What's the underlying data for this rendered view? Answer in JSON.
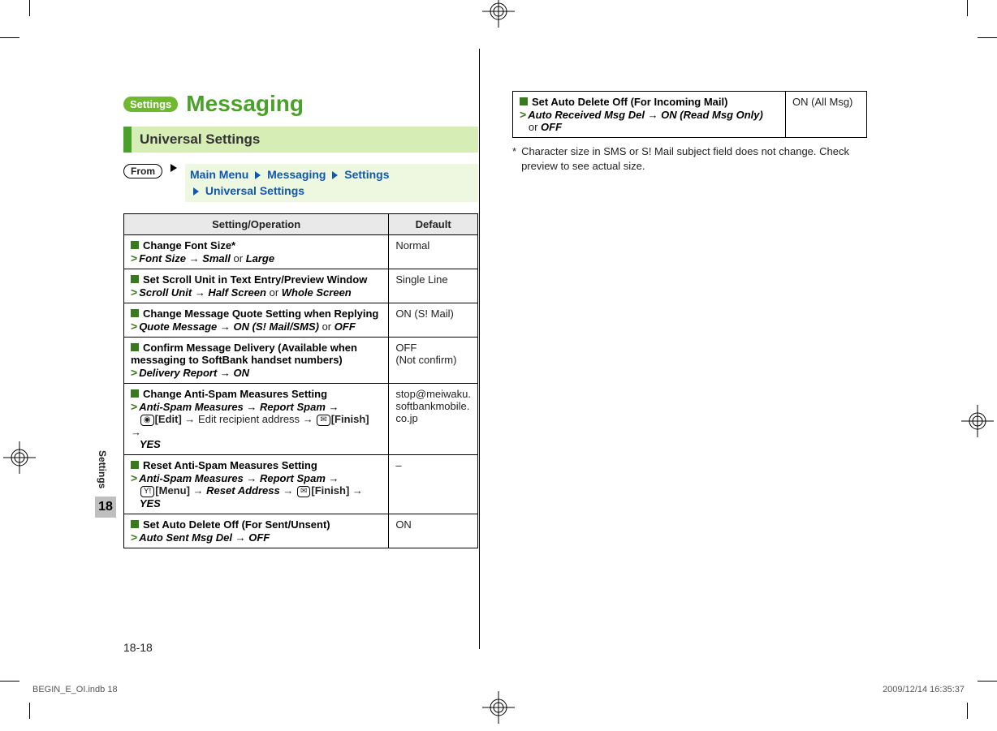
{
  "header": {
    "pill": "Settings",
    "title": "Messaging"
  },
  "section_title": "Universal Settings",
  "from_label": "From",
  "breadcrumb": {
    "p1": "Main Menu",
    "p2": "Messaging",
    "p3": "Settings",
    "p4": "Universal Settings"
  },
  "table_header": {
    "col1": "Setting/Operation",
    "col2": "Default"
  },
  "rows": [
    {
      "title": "Change Font Size*",
      "path_html": "<span class='chev'>&gt;</span><span class='path'>Font Size <span class='arr'>→</span> Small</span> <span class='normal'>or</span> <span class='path'>Large</span>",
      "default": "Normal"
    },
    {
      "title": "Set Scroll Unit in Text Entry/Preview Window",
      "path_html": "<span class='chev'>&gt;</span><span class='path'>Scroll Unit <span class='arr'>→</span> Half Screen</span> <span class='normal'>or</span> <span class='path'>Whole Screen</span>",
      "default": "Single Line"
    },
    {
      "title": "Change Message Quote Setting when Replying",
      "path_html": "<span class='chev'>&gt;</span><span class='path'>Quote Message <span class='arr'>→</span> ON (S! Mail/SMS)</span> <span class='normal'>or</span> <span class='path'>OFF</span>",
      "default": "ON (S! Mail)"
    },
    {
      "title": "Confirm Message Delivery (Available when messaging to SoftBank handset numbers)",
      "path_html": "<span class='chev'>&gt;</span><span class='path'>Delivery Report <span class='arr'>→</span> ON</span>",
      "default": "OFF<br>(Not confirm)"
    },
    {
      "title": "Change Anti-Spam Measures Setting",
      "path_html": "<span class='chev'>&gt;</span><span class='path'>Anti-Spam Measures <span class='arr'>→</span> Report Spam <span class='arr'>→</span></span><br>&nbsp;&nbsp;&nbsp;<span class='key'>◉</span><span class='bold'>[Edit]</span> <span class='arr'>→</span> <span class='normal'>Edit recipient address</span> <span class='arr'>→</span> <span class='key'>✉</span><span class='bold'>[Finish]</span> <span class='arr'>→</span><br>&nbsp;&nbsp;&nbsp;<span class='path'>YES</span>",
      "default": "stop@meiwaku.<br>softbankmobile.<br>co.jp"
    },
    {
      "title": "Reset Anti-Spam Measures Setting",
      "path_html": "<span class='chev'>&gt;</span><span class='path'>Anti-Spam Measures <span class='arr'>→</span> Report Spam <span class='arr'>→</span></span><br>&nbsp;&nbsp;&nbsp;<span class='key'>Y!</span><span class='bold'>[Menu]</span> <span class='arr'>→</span> <span class='path'>Reset Address</span> <span class='arr'>→</span> <span class='key'>✉</span><span class='bold'>[Finish]</span> <span class='arr'>→</span><br>&nbsp;&nbsp;&nbsp;<span class='path'>YES</span>",
      "default": "–"
    },
    {
      "title": "Set Auto Delete Off (For Sent/Unsent)",
      "path_html": "<span class='chev'>&gt;</span><span class='path'>Auto Sent Msg Del <span class='arr'>→</span> OFF</span>",
      "default": "ON"
    }
  ],
  "rows_right": [
    {
      "title": "Set Auto Delete Off (For Incoming Mail)",
      "path_html": "<span class='chev'>&gt;</span><span class='path'>Auto Received Msg Del <span class='arr'>→</span> ON (Read Msg Only)</span><br>&nbsp;&nbsp;&nbsp;<span class='normal'>or</span> <span class='path'>OFF</span>",
      "default": "ON (All Msg)"
    }
  ],
  "footnote": "Character size in SMS or S! Mail subject field does not change. Check preview to see actual size.",
  "sidebar": {
    "label": "Settings",
    "number": "18"
  },
  "page_number": "18-18",
  "footer": {
    "file": "BEGIN_E_OI.indb   18",
    "stamp": "2009/12/14   16:35:37"
  }
}
